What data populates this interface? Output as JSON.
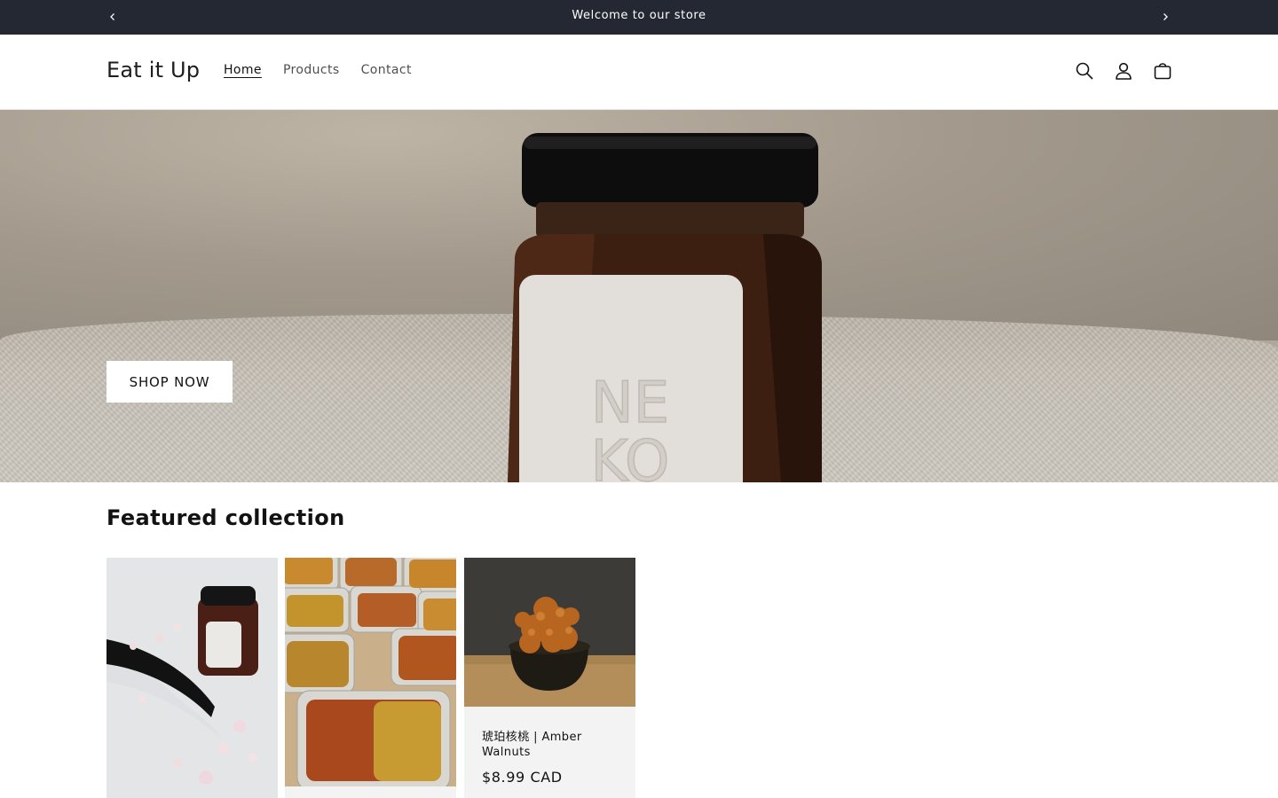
{
  "announcement": {
    "message": "Welcome to our store",
    "prev_icon": "chevron-left-icon",
    "next_icon": "chevron-right-icon"
  },
  "header": {
    "logo": "Eat it Up",
    "nav": [
      {
        "label": "Home",
        "active": true
      },
      {
        "label": "Products",
        "active": false
      },
      {
        "label": "Contact",
        "active": false
      }
    ],
    "icons": [
      "search-icon",
      "account-icon",
      "cart-icon"
    ]
  },
  "hero": {
    "button_label": "SHOP NOW",
    "jar_label_text": [
      "NE",
      "KO"
    ]
  },
  "featured": {
    "title": "Featured collection",
    "products": [
      {
        "title": "",
        "price": ""
      },
      {
        "title": "",
        "price": ""
      },
      {
        "title": "琥珀核桃 | Amber Walnuts",
        "price": "$8.99 CAD"
      }
    ]
  },
  "colors": {
    "announcement_bg": "#242833",
    "text": "#121212",
    "card_bg": "#f3f3f3"
  }
}
